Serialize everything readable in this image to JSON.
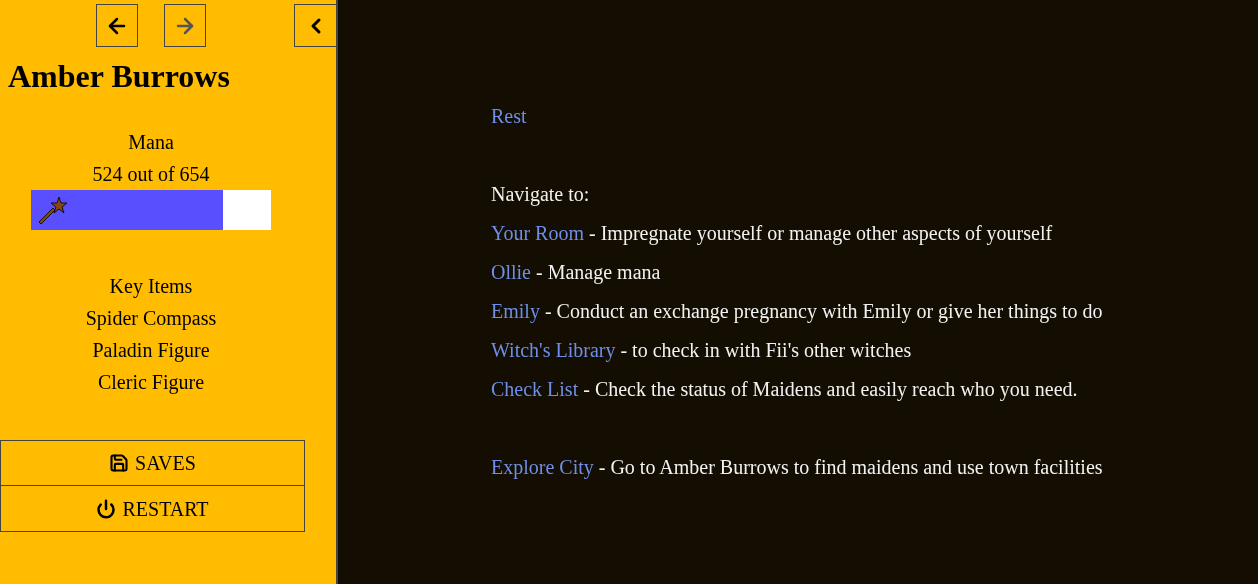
{
  "sidebar": {
    "history": [
      {
        "kind": "back",
        "disabled": false
      },
      {
        "kind": "forward",
        "disabled": true
      }
    ],
    "title": "Amber Burrows",
    "mana": {
      "label": "Mana",
      "reading": "524 out of 654",
      "level": 0.8
    },
    "key_items": {
      "heading": "Key Items",
      "items": [
        "Spider Compass",
        "Paladin Figure",
        "Cleric Figure"
      ]
    },
    "buttons": [
      {
        "kind": "save",
        "label": "SAVES"
      },
      {
        "kind": "restart",
        "label": "RESTART"
      }
    ]
  },
  "main": {
    "action": "Rest",
    "navigate_heading": "Navigate to:",
    "links": [
      {
        "label": "Your Room",
        "description": " - Impregnate yourself or manage other aspects of yourself"
      },
      {
        "label": "Ollie",
        "description": " - Manage mana"
      },
      {
        "label": "Emily",
        "description": " - Conduct an exchange pregnancy with Emily or give her things to do"
      },
      {
        "label": "Witch's Library",
        "description": " - to check in with Fii's other witches"
      },
      {
        "label": "Check List",
        "description": " - Check the status of Maidens and easily reach who you need."
      }
    ],
    "explore": {
      "label": "Explore City",
      "description": " - Go to Amber Burrows to find maidens and use town facilities"
    }
  }
}
